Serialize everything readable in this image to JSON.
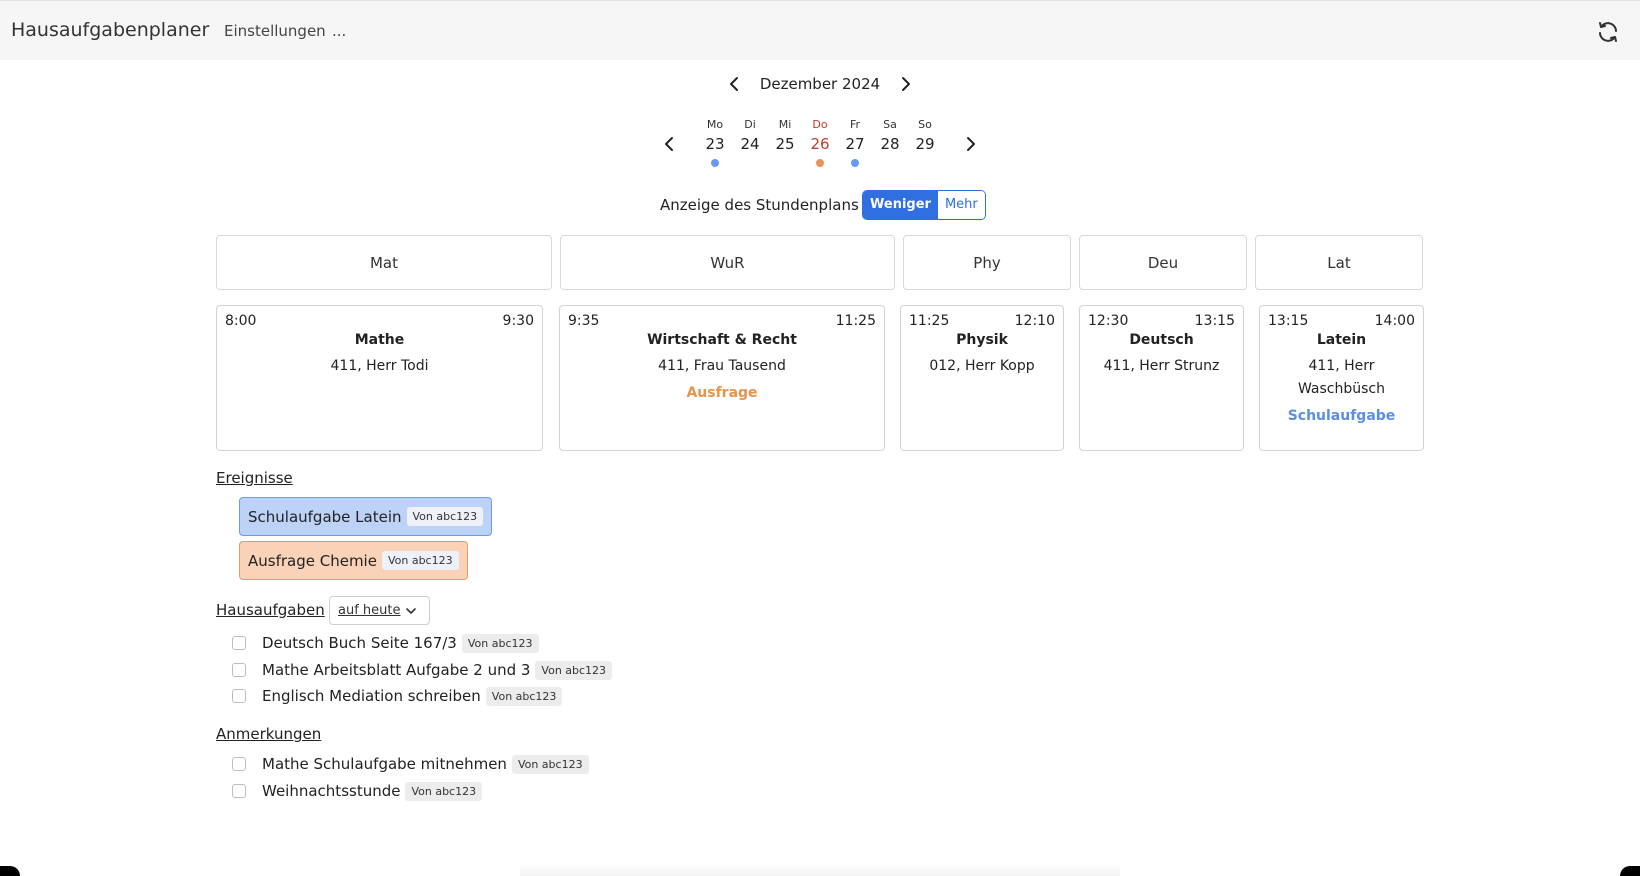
{
  "app": {
    "title": "Hausaufgabenplaner",
    "nav_settings": "Einstellungen",
    "nav_more": "..."
  },
  "icons": {
    "refresh": "refresh-icon",
    "prev": "chevron-left-icon",
    "next": "chevron-right-icon",
    "dropdown": "chevron-down-icon"
  },
  "colors": {
    "accent": "#2f6fe0",
    "today": "#c0392b",
    "exam": "#5b8fe6",
    "quiz": "#e8924a"
  },
  "month": {
    "label": "Dezember 2024"
  },
  "week": {
    "days": [
      {
        "name": "Mo",
        "date": "23",
        "dot": "#6a9af0"
      },
      {
        "name": "Di",
        "date": "24",
        "dot": null
      },
      {
        "name": "Mi",
        "date": "25",
        "dot": null
      },
      {
        "name": "Do",
        "date": "26",
        "dot": "#e8935a",
        "today": true
      },
      {
        "name": "Fr",
        "date": "27",
        "dot": "#6a9af0"
      },
      {
        "name": "Sa",
        "date": "28",
        "dot": null
      },
      {
        "name": "So",
        "date": "29",
        "dot": null
      }
    ]
  },
  "timetable": {
    "label": "Anzeige des Stundenplans",
    "less": "Weniger",
    "more": "Mehr"
  },
  "subjects": [
    "Mat",
    "WuR",
    "Phy",
    "Deu",
    "Lat"
  ],
  "lessons": [
    {
      "start": "8:00",
      "end": "9:30",
      "name": "Mathe",
      "room": "411, Herr Todi",
      "tag": ""
    },
    {
      "start": "9:35",
      "end": "11:25",
      "name": "Wirtschaft & Recht",
      "room": "411, Frau Tausend",
      "tag": "Ausfrage"
    },
    {
      "start": "11:25",
      "end": "12:10",
      "name": "Physik",
      "room": "012, Herr Kopp",
      "tag": ""
    },
    {
      "start": "12:30",
      "end": "13:15",
      "name": "Deutsch",
      "room": "411, Herr Strunz",
      "tag": ""
    },
    {
      "start": "13:15",
      "end": "14:00",
      "name": "Latein",
      "room": "411, Herr Waschbüsch",
      "tag": "Schulaufgabe"
    }
  ],
  "events": {
    "title": "Ereignisse",
    "items": [
      {
        "label": "Schulaufgabe Latein",
        "author": "Von abc123"
      },
      {
        "label": "Ausfrage Chemie",
        "author": "Von abc123"
      }
    ]
  },
  "homework": {
    "title": "Hausaufgaben",
    "filter": "auf heute",
    "items": [
      {
        "label": "Deutsch Buch Seite 167/3",
        "author": "Von abc123"
      },
      {
        "label": "Mathe Arbeitsblatt Aufgabe 2 und 3",
        "author": "Von abc123"
      },
      {
        "label": "Englisch Mediation schreiben",
        "author": "Von abc123"
      }
    ]
  },
  "notes": {
    "title": "Anmerkungen",
    "items": [
      {
        "label": "Mathe Schulaufgabe mitnehmen",
        "author": "Von abc123"
      },
      {
        "label": "Weihnachtsstunde",
        "author": "Von abc123"
      }
    ]
  }
}
